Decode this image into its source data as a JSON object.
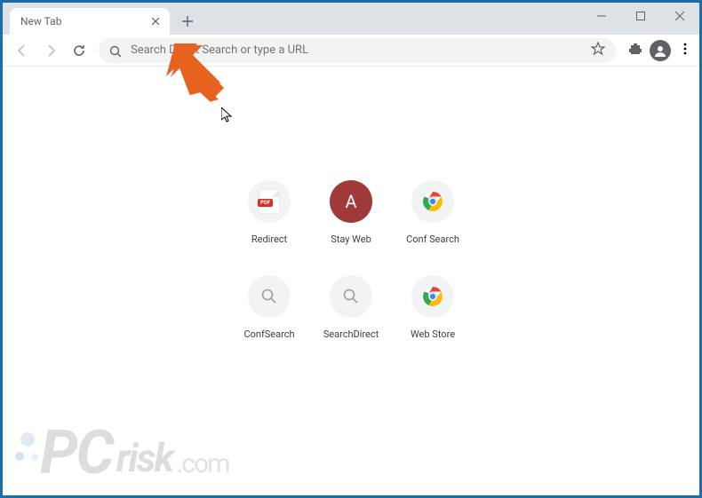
{
  "tab": {
    "title": "New Tab"
  },
  "omnibox": {
    "placeholder": "Search Direct Search or type a URL"
  },
  "shortcuts": [
    {
      "label": "Redirect",
      "icon": "pdf"
    },
    {
      "label": "Stay Web",
      "icon": "letter-a"
    },
    {
      "label": "Conf Search",
      "icon": "chrome"
    },
    {
      "label": "ConfSearch",
      "icon": "magnifier"
    },
    {
      "label": "SearchDirect",
      "icon": "magnifier"
    },
    {
      "label": "Web Store",
      "icon": "chrome"
    }
  ],
  "watermark": {
    "pc": "PC",
    "risk": "risk",
    "com": ".com"
  }
}
